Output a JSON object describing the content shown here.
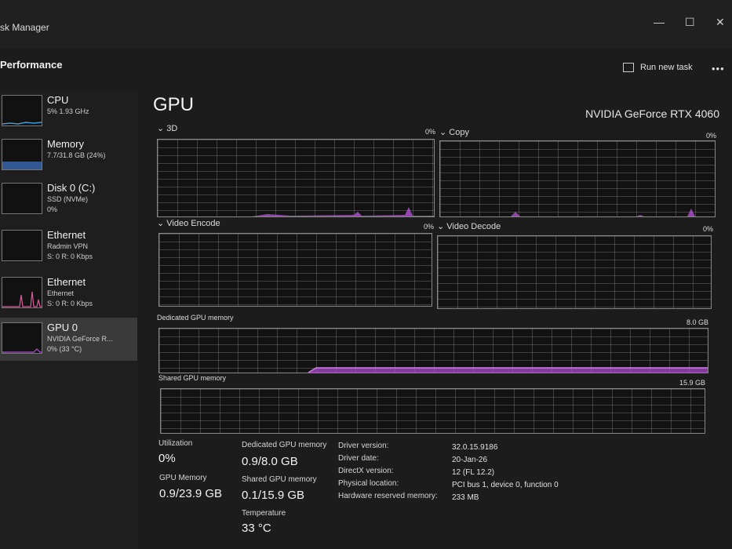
{
  "window": {
    "title": "sk Manager"
  },
  "window_controls": {
    "minimize": "—",
    "maximize": "☐",
    "close": "✕"
  },
  "header": {
    "section": "Performance",
    "run_task": "Run new task",
    "more": "•••"
  },
  "sidebar": {
    "items": [
      {
        "name": "CPU",
        "sub1": "5% 1.93 GHz",
        "sub2": ""
      },
      {
        "name": "Memory",
        "sub1": "7.7/31.8 GB (24%)",
        "sub2": ""
      },
      {
        "name": "Disk 0 (C:)",
        "sub1": "SSD (NVMe)",
        "sub2": "0%"
      },
      {
        "name": "Ethernet",
        "sub1": "Radmin VPN",
        "sub2": "S: 0 R: 0 Kbps"
      },
      {
        "name": "Ethernet",
        "sub1": "Ethernet",
        "sub2": "S: 0 R: 0 Kbps"
      },
      {
        "name": "GPU 0",
        "sub1": "NVIDIA GeForce R...",
        "sub2": "0% (33 °C)"
      }
    ]
  },
  "main": {
    "title": "GPU",
    "gpu_name": "NVIDIA GeForce RTX 4060",
    "graphs": [
      {
        "label": "3D",
        "value": "0%"
      },
      {
        "label": "Copy",
        "value": "0%"
      },
      {
        "label": "Video Encode",
        "value": "0%"
      },
      {
        "label": "Video Decode",
        "value": "0%"
      },
      {
        "label": "Dedicated GPU memory",
        "value": "8.0 GB"
      },
      {
        "label": "Shared GPU memory",
        "value": "15.9 GB"
      }
    ],
    "stats": {
      "utilization_label": "Utilization",
      "utilization_value": "0%",
      "gpu_memory_label": "GPU Memory",
      "gpu_memory_value": "0.9/23.9 GB",
      "dedicated_label": "Dedicated GPU memory",
      "dedicated_value": "0.9/8.0 GB",
      "shared_label": "Shared GPU memory",
      "shared_value": "0.1/15.9 GB",
      "temperature_label": "Temperature",
      "temperature_value": "33 °C"
    },
    "info": [
      {
        "label": "Driver version:",
        "value": "32.0.15.9186"
      },
      {
        "label": "Driver date:",
        "value": "20-Jan-26"
      },
      {
        "label": "DirectX version:",
        "value": "12 (FL 12.2)"
      },
      {
        "label": "Physical location:",
        "value": "PCI bus 1, device 0, function 0"
      },
      {
        "label": "Hardware reserved memory:",
        "value": "233 MB"
      }
    ]
  },
  "colors": {
    "gpu_accent": "#b44fd6",
    "memory_accent": "#3f73c9",
    "ethernet_accent": "#d95a9a"
  }
}
